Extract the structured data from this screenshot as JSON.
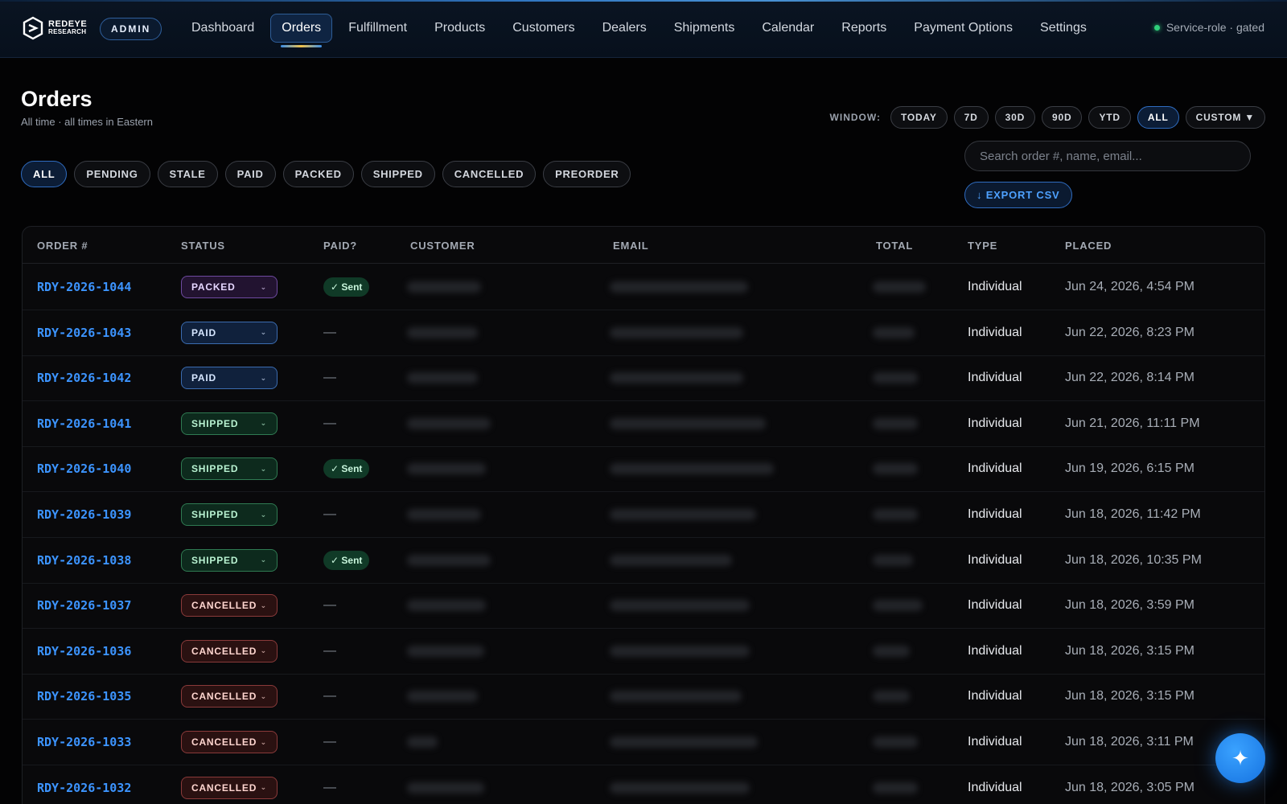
{
  "brand": {
    "line1": "REDEYE",
    "line2": "RESEARCH",
    "role_badge": "ADMIN"
  },
  "nav": [
    {
      "label": "Dashboard",
      "active": false
    },
    {
      "label": "Orders",
      "active": true
    },
    {
      "label": "Fulfillment",
      "active": false
    },
    {
      "label": "Products",
      "active": false
    },
    {
      "label": "Customers",
      "active": false
    },
    {
      "label": "Dealers",
      "active": false
    },
    {
      "label": "Shipments",
      "active": false
    },
    {
      "label": "Calendar",
      "active": false
    },
    {
      "label": "Reports",
      "active": false
    },
    {
      "label": "Payment Options",
      "active": false
    },
    {
      "label": "Settings",
      "active": false
    }
  ],
  "service_status": "Service-role · gated",
  "page": {
    "title": "Orders",
    "subtitle": "All time · all times in Eastern"
  },
  "window": {
    "label": "WINDOW:",
    "options": [
      {
        "label": "TODAY",
        "active": false
      },
      {
        "label": "7D",
        "active": false
      },
      {
        "label": "30D",
        "active": false
      },
      {
        "label": "90D",
        "active": false
      },
      {
        "label": "YTD",
        "active": false
      },
      {
        "label": "ALL",
        "active": true
      },
      {
        "label": "CUSTOM ▼",
        "active": false
      }
    ]
  },
  "filters": [
    {
      "label": "ALL",
      "active": true
    },
    {
      "label": "PENDING",
      "active": false
    },
    {
      "label": "STALE",
      "active": false
    },
    {
      "label": "PAID",
      "active": false
    },
    {
      "label": "PACKED",
      "active": false
    },
    {
      "label": "SHIPPED",
      "active": false
    },
    {
      "label": "CANCELLED",
      "active": false
    },
    {
      "label": "PREORDER",
      "active": false
    }
  ],
  "search": {
    "placeholder": "Search order #, name, email...",
    "value": ""
  },
  "export_label": "↓ EXPORT CSV",
  "table": {
    "columns": [
      "ORDER #",
      "STATUS",
      "PAID?",
      "CUSTOMER",
      "EMAIL",
      "TOTAL",
      "TYPE",
      "PLACED"
    ],
    "rows": [
      {
        "order": "RDY-2026-1044",
        "status": "PACKED",
        "paid": "✓ Sent",
        "type": "Individual",
        "placed": "Jun 24, 2026, 4:54 PM"
      },
      {
        "order": "RDY-2026-1043",
        "status": "PAID",
        "paid": "—",
        "type": "Individual",
        "placed": "Jun 22, 2026, 8:23 PM"
      },
      {
        "order": "RDY-2026-1042",
        "status": "PAID",
        "paid": "—",
        "type": "Individual",
        "placed": "Jun 22, 2026, 8:14 PM"
      },
      {
        "order": "RDY-2026-1041",
        "status": "SHIPPED",
        "paid": "—",
        "type": "Individual",
        "placed": "Jun 21, 2026, 11:11 PM"
      },
      {
        "order": "RDY-2026-1040",
        "status": "SHIPPED",
        "paid": "✓ Sent",
        "type": "Individual",
        "placed": "Jun 19, 2026, 6:15 PM"
      },
      {
        "order": "RDY-2026-1039",
        "status": "SHIPPED",
        "paid": "—",
        "type": "Individual",
        "placed": "Jun 18, 2026, 11:42 PM"
      },
      {
        "order": "RDY-2026-1038",
        "status": "SHIPPED",
        "paid": "✓ Sent",
        "type": "Individual",
        "placed": "Jun 18, 2026, 10:35 PM"
      },
      {
        "order": "RDY-2026-1037",
        "status": "CANCELLED",
        "paid": "—",
        "type": "Individual",
        "placed": "Jun 18, 2026, 3:59 PM"
      },
      {
        "order": "RDY-2026-1036",
        "status": "CANCELLED",
        "paid": "—",
        "type": "Individual",
        "placed": "Jun 18, 2026, 3:15 PM"
      },
      {
        "order": "RDY-2026-1035",
        "status": "CANCELLED",
        "paid": "—",
        "type": "Individual",
        "placed": "Jun 18, 2026, 3:15 PM"
      },
      {
        "order": "RDY-2026-1033",
        "status": "CANCELLED",
        "paid": "—",
        "type": "Individual",
        "placed": "Jun 18, 2026, 3:11 PM"
      },
      {
        "order": "RDY-2026-1032",
        "status": "CANCELLED",
        "paid": "—",
        "type": "Individual",
        "placed": "Jun 18, 2026, 3:05 PM"
      }
    ]
  },
  "fab_icon": "sparkle-icon"
}
